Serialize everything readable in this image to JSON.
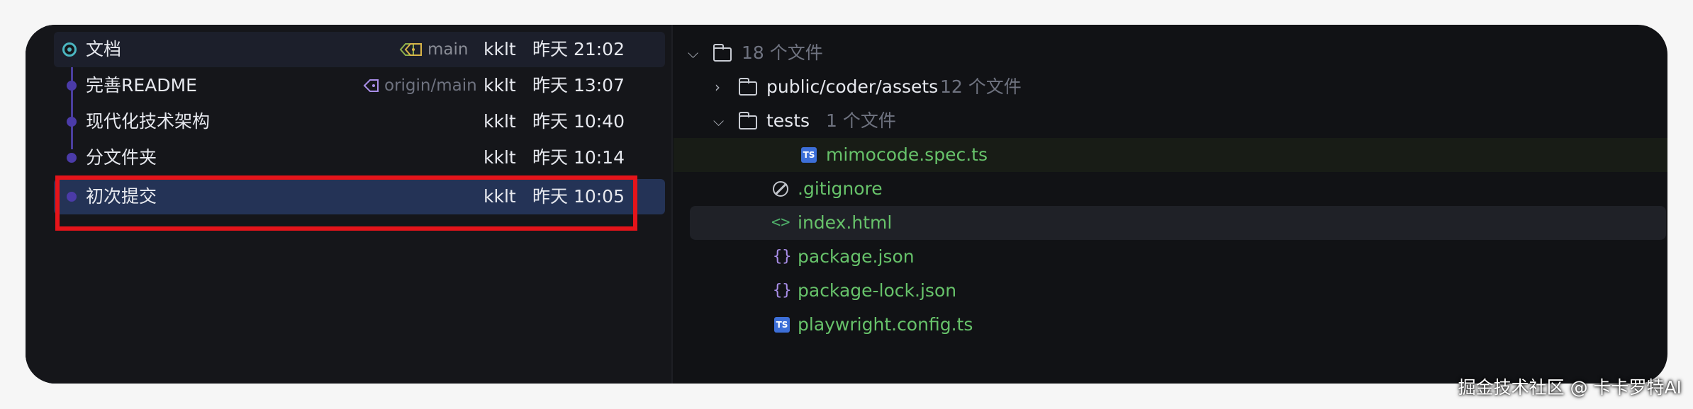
{
  "commits": [
    {
      "message": "文档",
      "tag": "main",
      "author": "kklt",
      "time": "昨天 21:02"
    },
    {
      "message": "完善README",
      "tag": "origin/main",
      "author": "kklt",
      "time": "昨天 13:07"
    },
    {
      "message": "现代化技术架构",
      "tag": "",
      "author": "kklt",
      "time": "昨天 10:40"
    },
    {
      "message": "分文件夹",
      "tag": "",
      "author": "kklt",
      "time": "昨天 10:14"
    },
    {
      "message": "初次提交",
      "tag": "",
      "author": "kklt",
      "time": "昨天 10:05"
    }
  ],
  "tree": {
    "root": {
      "label": "18 个文件"
    },
    "folders": [
      {
        "name": "public/coder/assets",
        "count": "12 个文件"
      },
      {
        "name": "tests",
        "count": "1 个文件"
      }
    ],
    "files": {
      "spec": "mimocode.spec.ts",
      "gitignore": ".gitignore",
      "index": "index.html",
      "package": "package.json",
      "package_lock": "package-lock.json",
      "playwright": "playwright.config.ts"
    }
  },
  "colors": {
    "highlight": "#e5141a",
    "file_green": "#67c26a",
    "selected_row": "#243356"
  },
  "watermark": "掘金技术社区 @ 卡卡罗特AI"
}
